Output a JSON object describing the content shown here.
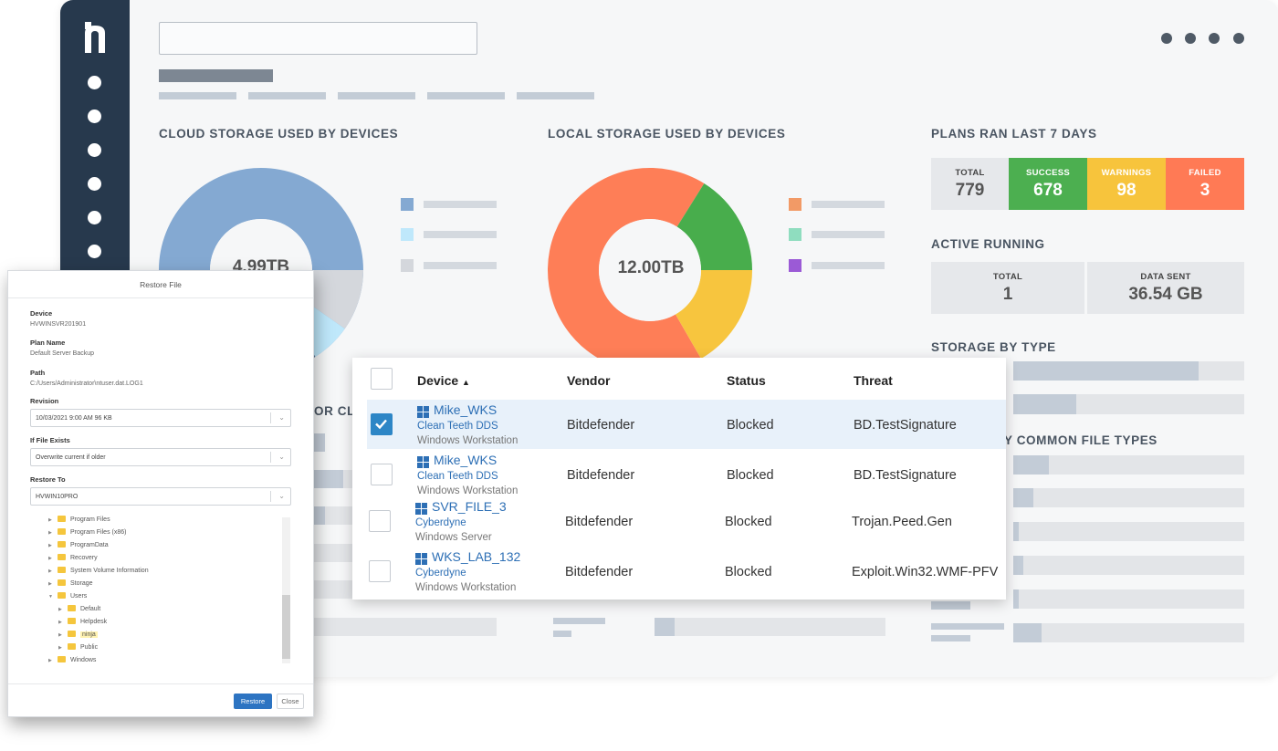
{
  "dashboard": {
    "cloud_title": "CLOUD STORAGE USED BY DEVICES",
    "cloud_total": "4.99TB",
    "local_title": "LOCAL STORAGE USED BY DEVICES",
    "local_total": "12.00TB",
    "clo_partial": "OR CLO",
    "plans": {
      "title": "PLANS RAN LAST 7 DAYS",
      "items": [
        {
          "label": "TOTAL",
          "value": "779",
          "color": "#e6e8eb"
        },
        {
          "label": "SUCCESS",
          "value": "678",
          "color": "#4caf50"
        },
        {
          "label": "WARNINGS",
          "value": "98",
          "color": "#f7c43c"
        },
        {
          "label": "FAILED",
          "value": "3",
          "color": "#ff7a55"
        }
      ]
    },
    "active": {
      "title": "ACTIVE RUNNING",
      "total_label": "TOTAL",
      "total_value": "1",
      "sent_label": "DATA SENT",
      "sent_value": "36.54 GB"
    },
    "storage_type_title": "STORAGE BY TYPE",
    "file_types_title": "Y COMMON FILE TYPES",
    "colors": {
      "cloud": [
        "#84a9d2",
        "#d4d7dc",
        "#bfe8fb",
        "#5a6f8c"
      ],
      "local": [
        "#fe7e57",
        "#48ad4c",
        "#f7c53e"
      ],
      "cloud_legend": [
        "#84a9d2",
        "#bfe8fb",
        "#d4d7dc"
      ],
      "local_legend": [
        "#f29a66",
        "#8fddbf",
        "#9b5ad6"
      ]
    }
  },
  "dialog": {
    "title": "Restore File",
    "device_label": "Device",
    "device_value": "HVWINSVR201901",
    "plan_label": "Plan Name",
    "plan_value": "Default Server Backup",
    "path_label": "Path",
    "path_value": "C:/Users/Administrator\\ntuser.dat.LOG1",
    "revision_label": "Revision",
    "revision_value": "10/03/2021 9:00 AM 96 KB",
    "exists_label": "If File Exists",
    "exists_value": "Overwrite current if older",
    "restore_to_label": "Restore To",
    "restore_to_value": "HVWIN10PRO",
    "tree": [
      "Program Files",
      "Program Files (x86)",
      "ProgramData",
      "Recovery",
      "System Volume Information",
      "Storage",
      "Users",
      "Default",
      "Helpdesk",
      "ninja",
      "Public",
      "Windows"
    ],
    "restore_button": "Restore",
    "close_button": "Close"
  },
  "table": {
    "headers": {
      "device": "Device",
      "sort": "▲",
      "vendor": "Vendor",
      "status": "Status",
      "threat": "Threat"
    },
    "rows": [
      {
        "device": "Mike_WKS",
        "customer": "Clean Teeth DDS",
        "os": "Windows Workstation",
        "vendor": "Bitdefender",
        "status": "Blocked",
        "threat": "BD.TestSignature"
      },
      {
        "device": "Mike_WKS",
        "customer": "Clean Teeth DDS",
        "os": "Windows Workstation",
        "vendor": "Bitdefender",
        "status": "Blocked",
        "threat": "BD.TestSignature"
      },
      {
        "device": "SVR_FILE_3",
        "customer": "Cyberdyne",
        "os": "Windows Server",
        "vendor": "Bitdefender",
        "status": "Blocked",
        "threat": "Trojan.Peed.Gen"
      },
      {
        "device": "WKS_LAB_132",
        "customer": "Cyberdyne",
        "os": "Windows Workstation",
        "vendor": "Bitdefender",
        "status": "Blocked",
        "threat": "Exploit.Win32.WMF-PFV"
      }
    ]
  }
}
